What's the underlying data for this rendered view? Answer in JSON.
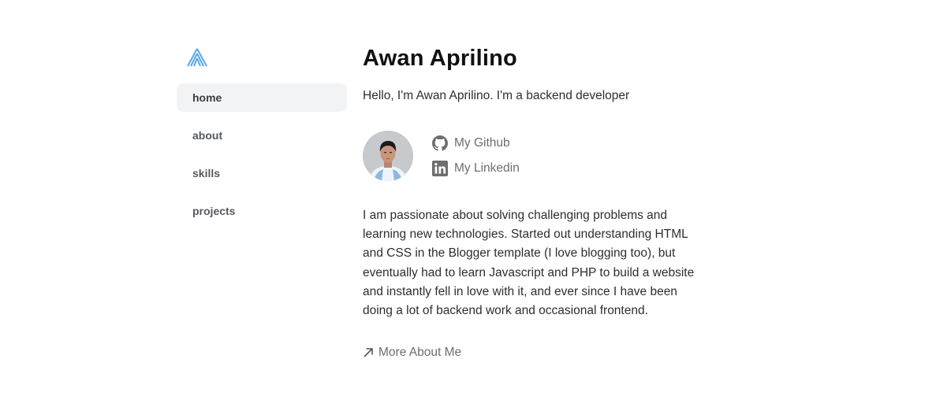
{
  "sidebar": {
    "logo_icon": "triangle-logo-icon",
    "logo_color": "#5aa7e6",
    "items": [
      {
        "label": "home",
        "active": true
      },
      {
        "label": "about",
        "active": false
      },
      {
        "label": "skills",
        "active": false
      },
      {
        "label": "projects",
        "active": false
      }
    ]
  },
  "main": {
    "title": "Awan Aprilino",
    "intro": "Hello, I'm Awan Aprilino. I'm a backend developer",
    "avatar_icon": "profile-photo",
    "social": {
      "github_label": "My Github",
      "github_icon": "github-icon",
      "linkedin_label": "My Linkedin",
      "linkedin_icon": "linkedin-icon"
    },
    "about_lines": [
      "I am passionate about solving challenging problems and",
      "learning new technologies. Started out understanding HTML",
      "and CSS in the Blogger template (I love blogging too), but",
      "eventually had to learn Javascript and PHP to build a website",
      "and instantly fell in love with it, and ever since I have been",
      "doing a lot of backend work and occasional frontend."
    ],
    "more_label": "More About Me",
    "more_icon": "arrow-up-right-icon"
  },
  "colors": {
    "nav_active_bg": "#f2f3f5",
    "muted_text": "#6e6e6e",
    "accent": "#5aa7e6"
  }
}
